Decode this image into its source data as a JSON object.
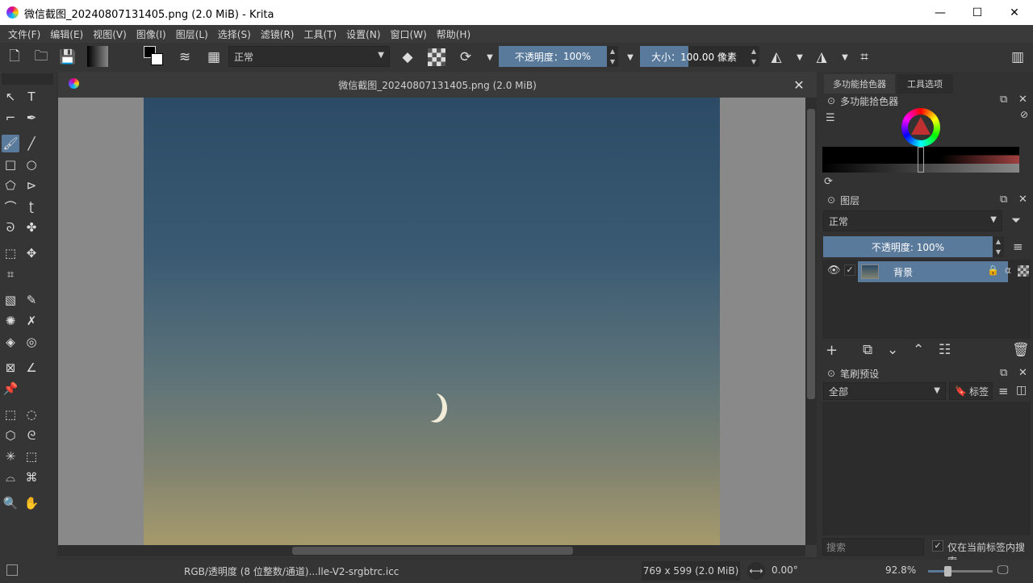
{
  "window": {
    "title": "微信截图_20240807131405.png (2.0 MiB)  - Krita",
    "minimize": "—",
    "maximize": "☐",
    "close": "✕"
  },
  "menu": [
    "文件(F)",
    "编辑(E)",
    "视图(V)",
    "图像(I)",
    "图层(L)",
    "选择(S)",
    "滤镜(R)",
    "工具(T)",
    "设置(N)",
    "窗口(W)",
    "帮助(H)"
  ],
  "toolbar": {
    "blend_mode": "正常",
    "opacity_label": "不透明度：",
    "opacity_value": "100%",
    "size_label": "大小：",
    "size_value": "100.00 像素"
  },
  "document": {
    "tab_title": "微信截图_20240807131405.png (2.0 MiB)",
    "close": "✕"
  },
  "dock": {
    "tab_color": "多功能拾色器",
    "tab_tools": "工具选项",
    "color_panel_title": "多功能拾色器",
    "layers_title": "图层",
    "layers_blend": "正常",
    "layers_opacity": "不透明度:  100%",
    "layer_name": "背景",
    "brush_title": "笔刷预设",
    "brush_filter": "全部",
    "brush_tag": "标签",
    "search_placeholder": "搜索",
    "search_in_tag": "仅在当前标签内搜索"
  },
  "status": {
    "color_space": "RGB/透明度 (8 位整数/通道)...lle-V2-srgbtrc.icc",
    "dimensions": "769 x 599 (2.0 MiB)",
    "rotation": "0.00°",
    "zoom": "92.8%"
  },
  "colors": {
    "accent": "#5a7a9c",
    "background": "#323232"
  }
}
